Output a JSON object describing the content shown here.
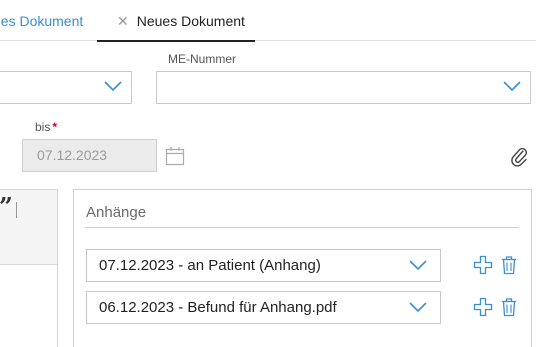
{
  "tabs": [
    {
      "label": "ues Dokument",
      "active": false
    },
    {
      "label": "Neues Dokument",
      "active": true,
      "close_icon": "close-icon"
    }
  ],
  "fields": {
    "me_number_label": "ME-Nummer",
    "me_number_value": "",
    "first_select_value": "",
    "bis_label": "bis",
    "required_mark": "*",
    "bis_date": "07.12.2023"
  },
  "editor": {
    "quote_glyph": "”"
  },
  "attachments": {
    "title": "Anhänge",
    "items": [
      {
        "label": "07.12.2023 - an Patient (Anhang)"
      },
      {
        "label": "06.12.2023 - Befund für Anhang.pdf"
      }
    ]
  },
  "icons": {
    "calendar": "calendar-icon",
    "paperclip": "paperclip-icon",
    "add": "plus-icon",
    "delete": "trash-icon",
    "dropdown": "chevron-down-icon"
  },
  "colors": {
    "accent": "#3a8fd0",
    "required": "#d0021b",
    "disabled_bg": "#ebebeb"
  }
}
